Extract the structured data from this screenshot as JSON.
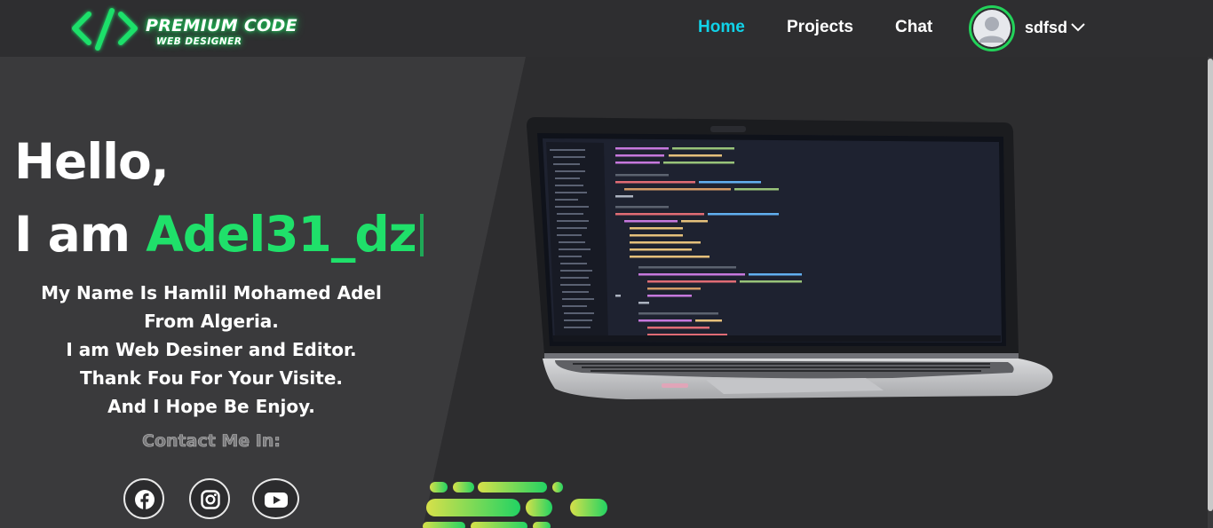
{
  "brand": {
    "title": "PREMIUM CODE",
    "subtitle": "WEB DESIGNER",
    "accent": "#1dd35c"
  },
  "nav": {
    "items": [
      {
        "label": "Home",
        "active": true
      },
      {
        "label": "Projects",
        "active": false
      },
      {
        "label": "Chat",
        "active": false
      }
    ],
    "active_color": "#11d2e8"
  },
  "user": {
    "name": "sdfsd",
    "avatar_icon": "default-user-icon",
    "ring_color": "#22d35a"
  },
  "hero": {
    "greeting": "Hello,",
    "iam_prefix": "I am ",
    "iam_name": "Adel31_dz",
    "bio_lines": [
      "My Name Is Hamlil Mohamed Adel From Algeria.",
      "I am Web Desiner and Editor.",
      "Thank Fou For Your Visite.",
      "And I Hope Be Enjoy."
    ],
    "contact_label": "Contact Me In:",
    "name_color": "#1fe06a"
  },
  "social": [
    {
      "icon": "facebook-icon"
    },
    {
      "icon": "instagram-icon"
    },
    {
      "icon": "youtube-icon"
    }
  ]
}
